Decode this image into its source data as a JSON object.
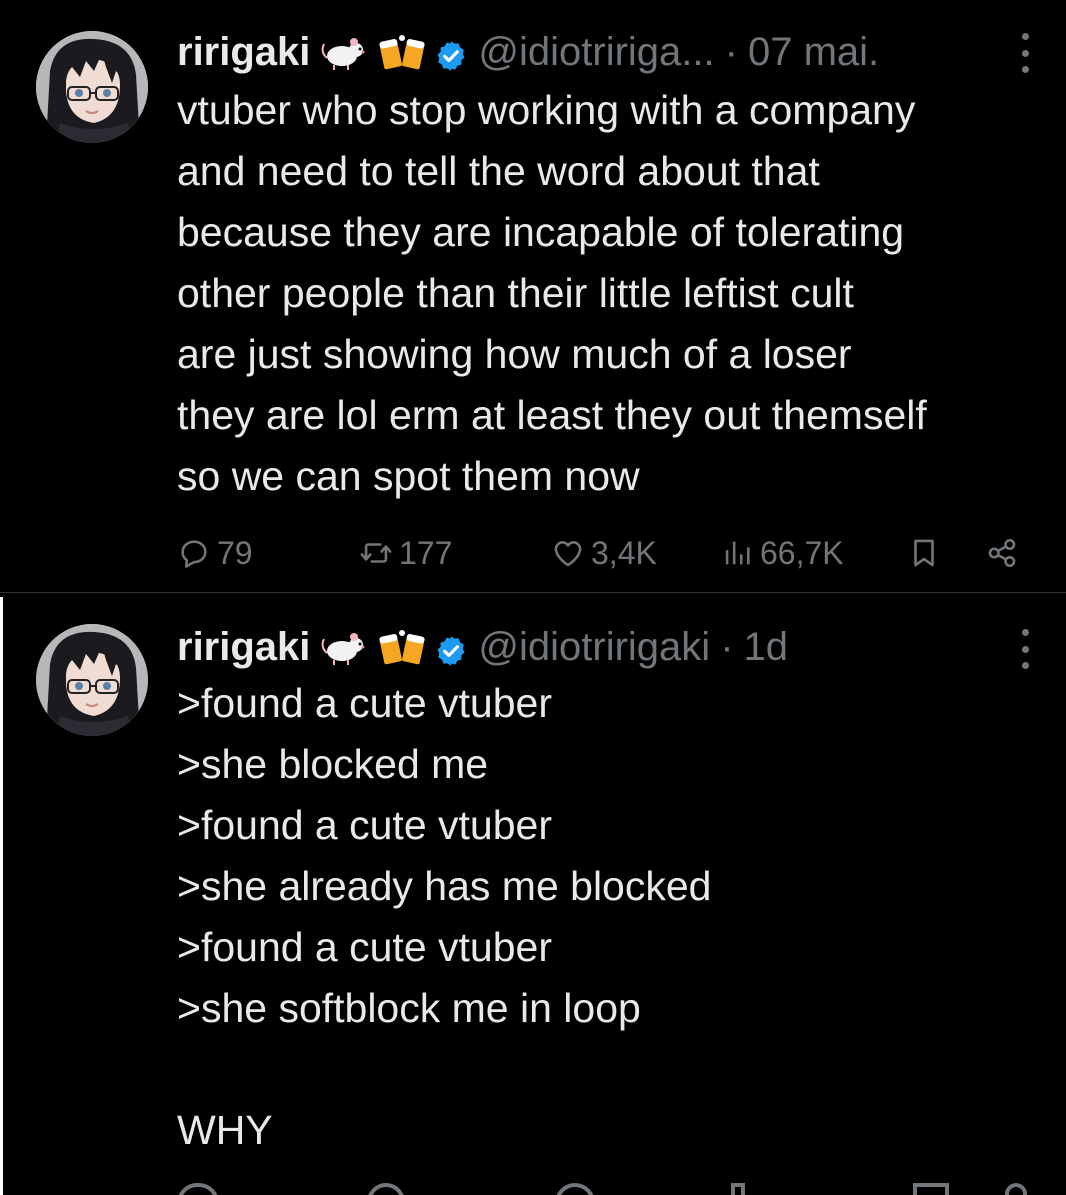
{
  "tweets": [
    {
      "author": {
        "display_name": "ririgaki",
        "emoji": [
          "rat-emoji",
          "beer-mugs-emoji"
        ],
        "verified": true,
        "handle": "@idiotririga...",
        "time": "07 mai."
      },
      "text": "vtuber who stop working with a company\nand need to tell the word about that\nbecause they are incapable of tolerating\nother people than their little leftist cult\nare just showing how much of a loser\nthey are lol erm at least they out themself\nso we can spot them now",
      "stats": {
        "replies": "79",
        "retweets": "177",
        "likes": "3,4K",
        "views": "66,7K"
      }
    },
    {
      "author": {
        "display_name": "ririgaki",
        "emoji": [
          "rat-emoji",
          "beer-mugs-emoji"
        ],
        "verified": true,
        "handle": "@idiotririgaki",
        "time": "1d"
      },
      "text": ">found a cute vtuber\n>she blocked me\n>found a cute vtuber\n>she already has me blocked\n>found a cute vtuber\n>she softblock me in loop\n\nWHY"
    }
  ],
  "colors": {
    "background": "#000000",
    "text_primary": "#e7e9ea",
    "text_secondary": "#71767b",
    "verified_blue": "#1d9bf0",
    "divider": "#2f3336"
  },
  "icons": {
    "reply": "speech-bubble-icon",
    "retweet": "retweet-arrows-icon",
    "like": "heart-icon",
    "views": "bar-chart-icon",
    "bookmark": "bookmark-icon",
    "share": "share-nodes-icon",
    "more": "vertical-ellipsis-icon",
    "verified": "verified-badge-icon"
  }
}
